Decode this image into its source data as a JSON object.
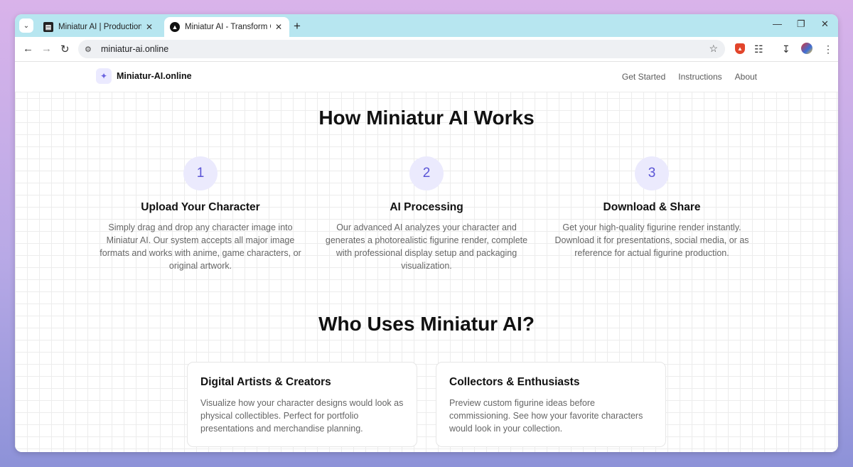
{
  "browser": {
    "tabs": [
      {
        "title": "Miniatur AI | Production | Sanity",
        "active": false
      },
      {
        "title": "Miniatur AI - Transform Charact",
        "active": true
      }
    ],
    "url": "miniatur-ai.online"
  },
  "site": {
    "brand": "Miniatur-AI.online",
    "nav": [
      "Get Started",
      "Instructions",
      "About"
    ]
  },
  "how": {
    "heading": "How Miniatur AI Works",
    "steps": [
      {
        "number": "1",
        "title": "Upload Your Character",
        "desc": "Simply drag and drop any character image into Miniatur AI. Our system accepts all major image formats and works with anime, game characters, or original artwork."
      },
      {
        "number": "2",
        "title": "AI Processing",
        "desc": "Our advanced AI analyzes your character and generates a photorealistic figurine render, complete with professional display setup and packaging visualization."
      },
      {
        "number": "3",
        "title": "Download & Share",
        "desc": "Get your high-quality figurine render instantly. Download it for presentations, social media, or as reference for actual figurine production."
      }
    ]
  },
  "who": {
    "heading": "Who Uses Miniatur AI?",
    "cards": [
      {
        "title": "Digital Artists & Creators",
        "desc": "Visualize how your character designs would look as physical collectibles. Perfect for portfolio presentations and merchandise planning."
      },
      {
        "title": "Collectors & Enthusiasts",
        "desc": "Preview custom figurine ideas before commissioning. See how your favorite characters would look in your collection."
      }
    ]
  }
}
